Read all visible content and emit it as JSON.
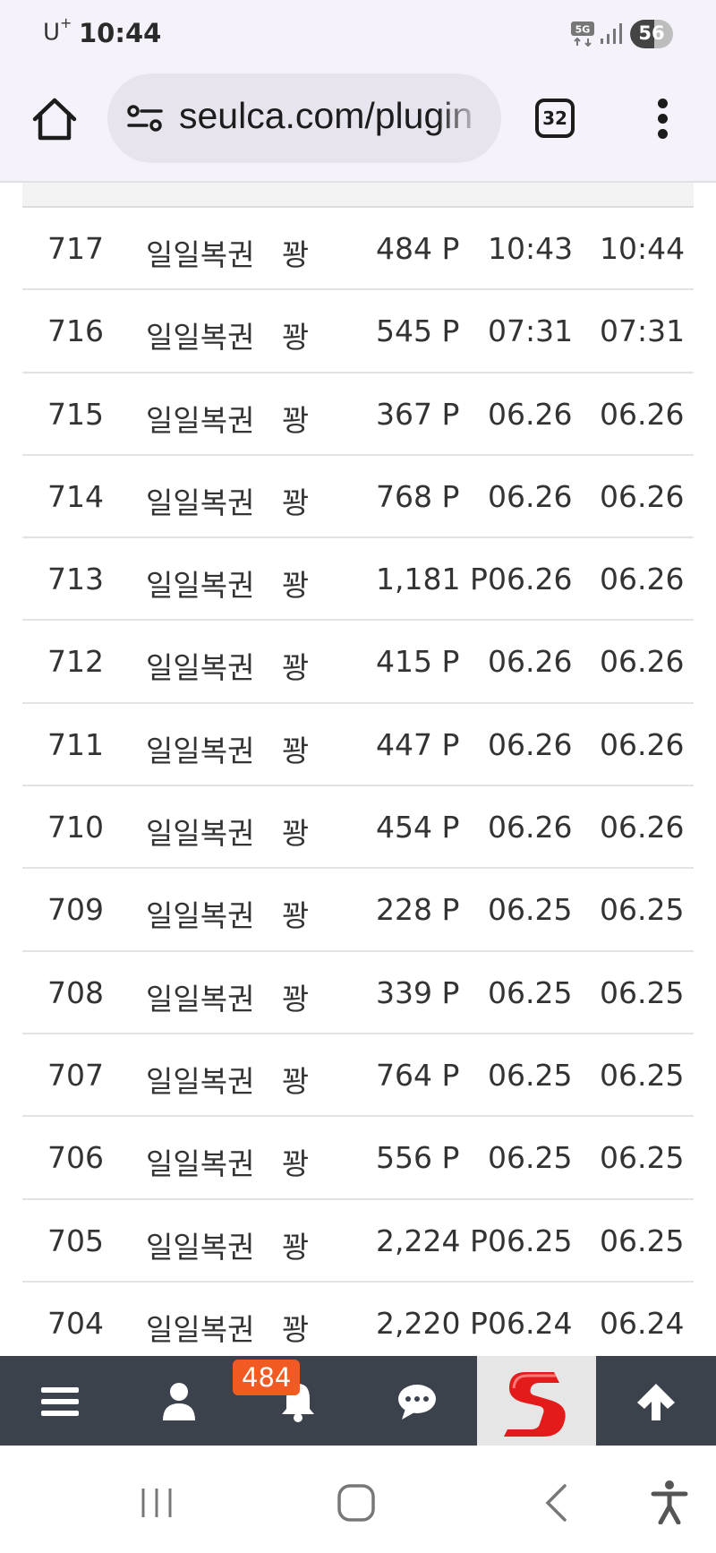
{
  "status_bar": {
    "carrier": "U",
    "carrier_sup": "+",
    "time": "10:44",
    "network": "5G",
    "battery": "56",
    "battery_level": 0.56
  },
  "browser": {
    "url": "seulca.com/plugin",
    "tab_count": "32"
  },
  "table": {
    "rows": [
      {
        "no": "717",
        "name": "일일복권",
        "type": "꽝",
        "point": "484 P",
        "date1": "10:43",
        "date2": "10:44"
      },
      {
        "no": "716",
        "name": "일일복권",
        "type": "꽝",
        "point": "545 P",
        "date1": "07:31",
        "date2": "07:31"
      },
      {
        "no": "715",
        "name": "일일복권",
        "type": "꽝",
        "point": "367 P",
        "date1": "06.26",
        "date2": "06.26"
      },
      {
        "no": "714",
        "name": "일일복권",
        "type": "꽝",
        "point": "768 P",
        "date1": "06.26",
        "date2": "06.26"
      },
      {
        "no": "713",
        "name": "일일복권",
        "type": "꽝",
        "point": "1,181 P",
        "date1": "06.26",
        "date2": "06.26"
      },
      {
        "no": "712",
        "name": "일일복권",
        "type": "꽝",
        "point": "415 P",
        "date1": "06.26",
        "date2": "06.26"
      },
      {
        "no": "711",
        "name": "일일복권",
        "type": "꽝",
        "point": "447 P",
        "date1": "06.26",
        "date2": "06.26"
      },
      {
        "no": "710",
        "name": "일일복권",
        "type": "꽝",
        "point": "454 P",
        "date1": "06.26",
        "date2": "06.26"
      },
      {
        "no": "709",
        "name": "일일복권",
        "type": "꽝",
        "point": "228 P",
        "date1": "06.25",
        "date2": "06.25"
      },
      {
        "no": "708",
        "name": "일일복권",
        "type": "꽝",
        "point": "339 P",
        "date1": "06.25",
        "date2": "06.25"
      },
      {
        "no": "707",
        "name": "일일복권",
        "type": "꽝",
        "point": "764 P",
        "date1": "06.25",
        "date2": "06.25"
      },
      {
        "no": "706",
        "name": "일일복권",
        "type": "꽝",
        "point": "556 P",
        "date1": "06.25",
        "date2": "06.25"
      },
      {
        "no": "705",
        "name": "일일복권",
        "type": "꽝",
        "point": "2,224 P",
        "date1": "06.25",
        "date2": "06.25"
      },
      {
        "no": "704",
        "name": "일일복권",
        "type": "꽝",
        "point": "2,220 P",
        "date1": "06.24",
        "date2": "06.24"
      }
    ]
  },
  "site_nav": {
    "items": [
      {
        "icon": "menu-icon"
      },
      {
        "icon": "user-icon"
      },
      {
        "icon": "bell-icon"
      },
      {
        "icon": "chat-icon"
      },
      {
        "icon": "site-logo"
      },
      {
        "icon": "arrow-up-icon"
      }
    ],
    "notification_badge": "484",
    "nav_bg": "#3b424c",
    "badge_color": "#f15a22",
    "logo_color": "#e31b1b"
  },
  "android_nav": {
    "items": [
      "recents-icon",
      "home-icon",
      "back-icon",
      "accessibility-icon"
    ]
  }
}
